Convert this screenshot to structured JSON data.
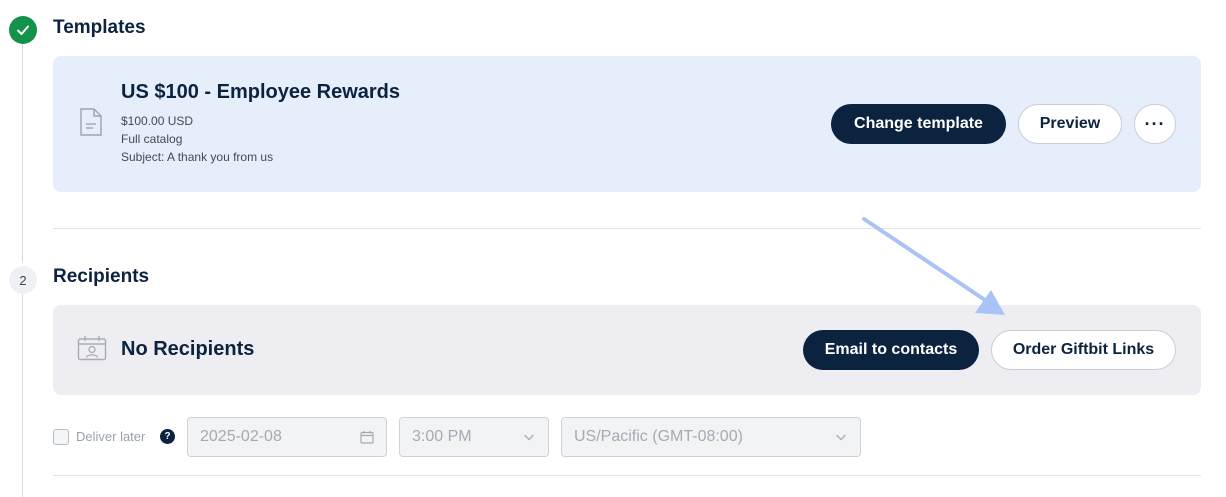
{
  "steps": {
    "templates": {
      "title": "Templates",
      "status": "done"
    },
    "recipients": {
      "number": "2",
      "title": "Recipients"
    }
  },
  "template_card": {
    "title": "US $100 - Employee Rewards",
    "amount": "$100.00 USD",
    "catalog": "Full catalog",
    "subject": "Subject: A thank you from us",
    "icon": "document-icon",
    "buttons": {
      "change_template": "Change template",
      "preview": "Preview",
      "more": "···"
    }
  },
  "recipients_card": {
    "title": "No Recipients",
    "icon": "contact-calendar-icon",
    "buttons": {
      "email_to_contacts": "Email to contacts",
      "order_giftbit_links": "Order Giftbit Links"
    }
  },
  "delivery": {
    "deliver_later_label": "Deliver later",
    "deliver_later_checked": false,
    "help_icon": "?",
    "date_value": "2025-02-08",
    "time_value": "3:00 PM",
    "timezone_value": "US/Pacific (GMT-08:00)"
  },
  "colors": {
    "navy": "#0c2340",
    "success": "#14924a",
    "template_card_bg": "#e6eefc",
    "recipient_card_bg": "#eeeef2",
    "annotation_arrow": "#a9c3f7"
  }
}
